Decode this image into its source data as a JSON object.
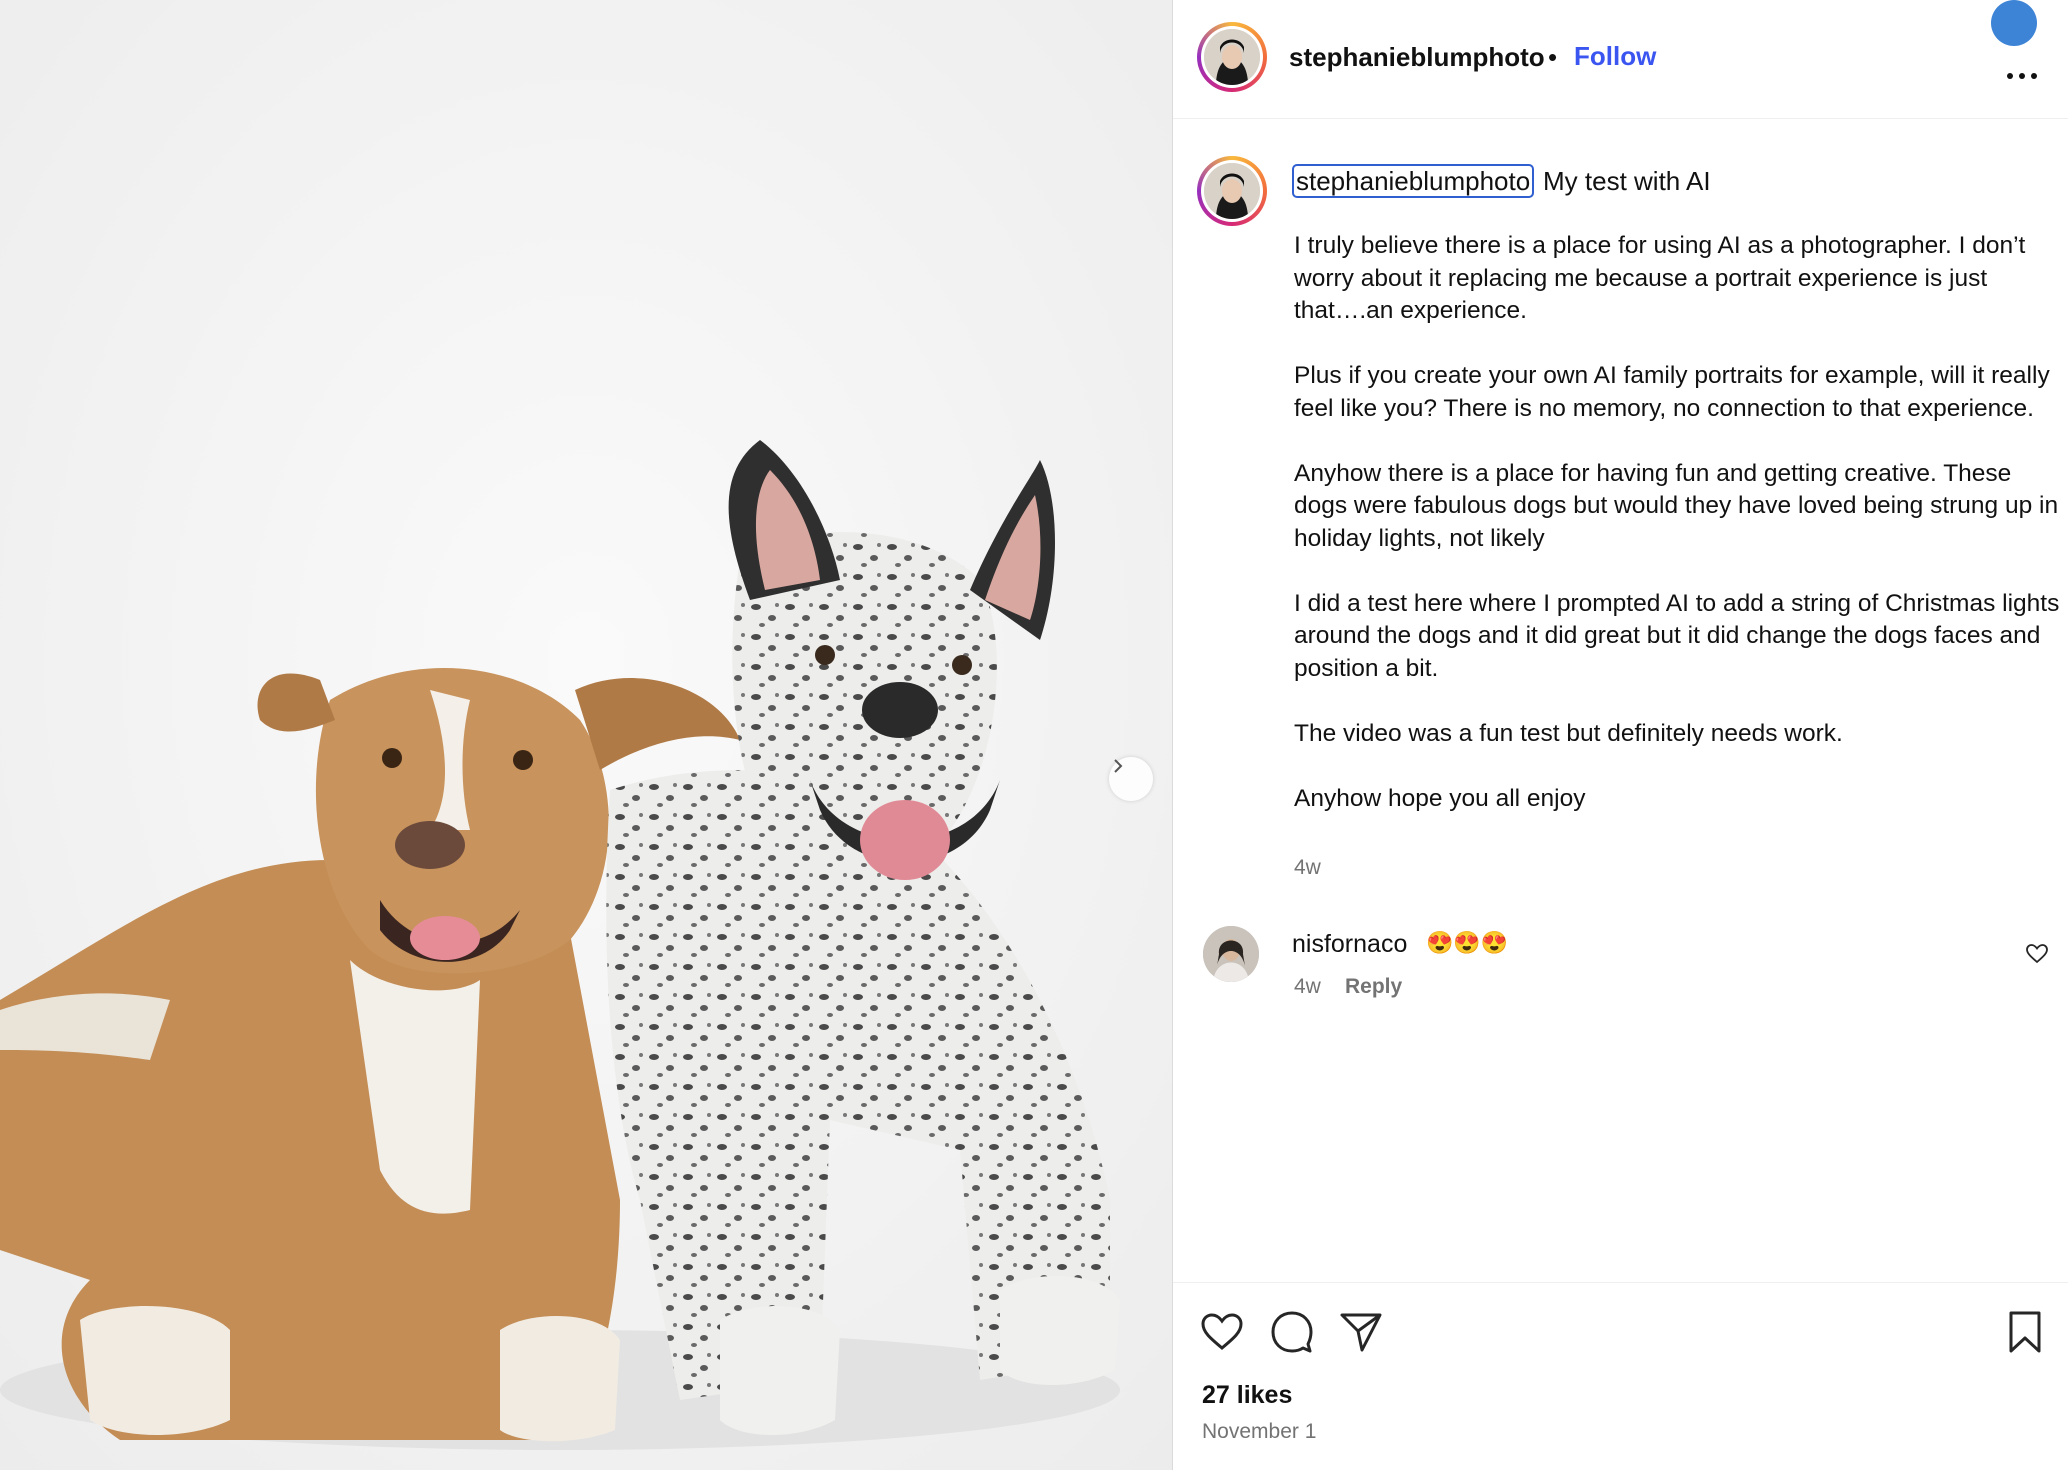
{
  "post": {
    "author": "stephanieblumphoto",
    "follow_label": "Follow",
    "separator": "•"
  },
  "caption": {
    "username": "stephanieblumphoto",
    "title": "My test with AI",
    "paragraphs": [
      "I truly believe there is a place for using AI as a photographer. I don’t worry about it replacing me because a portrait experience is just that….an experience.",
      "Plus if you create your own AI family portraits for example, will it really feel like you? There is no memory, no connection to that experience.",
      "Anyhow there is a place for having fun and getting creative. These dogs were fabulous dogs but would they have loved being strung up in holiday lights, not likely",
      "I did a test here where I prompted AI to add a string of Christmas lights around the dogs and it did great but it did change the dogs faces and position a bit.",
      "The video was a fun test but definitely needs work.",
      "Anyhow hope you all enjoy"
    ],
    "time": "4w"
  },
  "comments": [
    {
      "username": "nisfornaco",
      "text": "😍😍😍",
      "time": "4w",
      "reply_label": "Reply"
    }
  ],
  "stats": {
    "likes": "27 likes",
    "date": "November 1"
  },
  "icons": {
    "like": "heart-icon",
    "comment": "comment-icon",
    "share": "share-icon",
    "save": "bookmark-icon",
    "more": "more-options-icon",
    "next": "chevron-right-icon"
  },
  "colors": {
    "follow": "#3a55f0",
    "secondary_text": "#737373"
  }
}
